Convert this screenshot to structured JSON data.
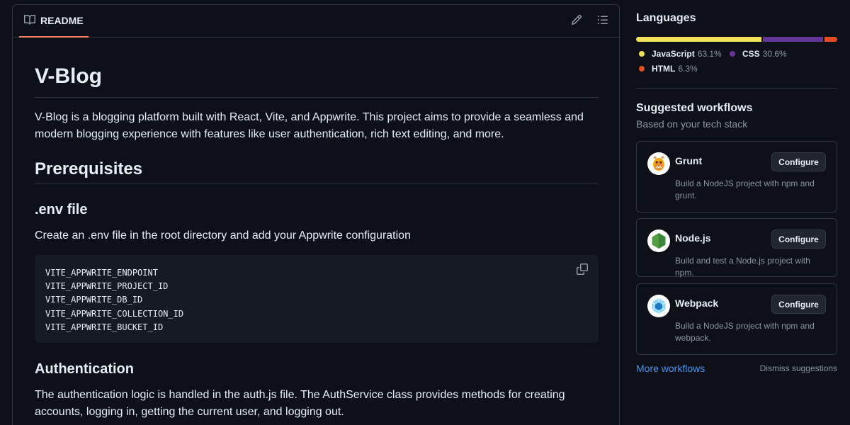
{
  "readme": {
    "tab_label": "README",
    "title": "V-Blog",
    "intro": "V-Blog is a blogging platform built with React, Vite, and Appwrite. This project aims to provide a seamless and modern blogging experience with features like user authentication, rich text editing, and more.",
    "h_prerequisites": "Prerequisites",
    "h_env": ".env file",
    "env_text": "Create an .env file in the root directory and add your Appwrite configuration",
    "code_lines": [
      "VITE_APPWRITE_ENDPOINT",
      "VITE_APPWRITE_PROJECT_ID",
      "VITE_APPWRITE_DB_ID",
      "VITE_APPWRITE_COLLECTION_ID",
      "VITE_APPWRITE_BUCKET_ID"
    ],
    "h_auth": "Authentication",
    "auth_text": "The authentication logic is handled in the auth.js file. The AuthService class provides methods for creating accounts, logging in, getting the current user, and logging out."
  },
  "languages": {
    "title": "Languages",
    "items": [
      {
        "name": "JavaScript",
        "percent": "63.1%",
        "value": 63.1,
        "color": "#f1e05a"
      },
      {
        "name": "CSS",
        "percent": "30.6%",
        "value": 30.6,
        "color": "#663399"
      },
      {
        "name": "HTML",
        "percent": "6.3%",
        "value": 6.3,
        "color": "#e34c26"
      }
    ]
  },
  "workflows": {
    "title": "Suggested workflows",
    "subtitle": "Based on your tech stack",
    "configure_label": "Configure",
    "items": [
      {
        "name": "Grunt",
        "desc": "Build a NodeJS project with npm and grunt.",
        "icon": "grunt-icon"
      },
      {
        "name": "Node.js",
        "desc": "Build and test a Node.js project with npm.",
        "icon": "nodejs-icon"
      },
      {
        "name": "Webpack",
        "desc": "Build a NodeJS project with npm and webpack.",
        "icon": "webpack-icon"
      }
    ],
    "more_label": "More workflows",
    "dismiss_label": "Dismiss suggestions"
  }
}
